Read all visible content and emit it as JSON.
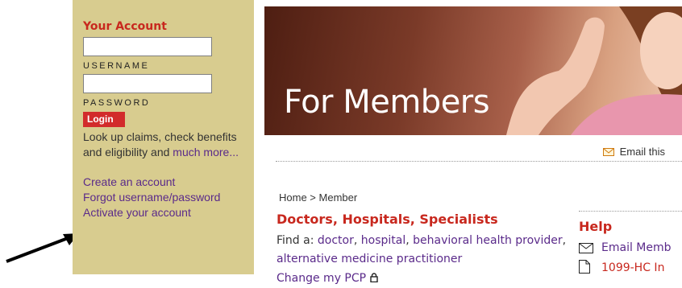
{
  "account": {
    "title": "Your Account",
    "username_label": "USERNAME",
    "password_label": "PASSWORD",
    "username_value": "",
    "password_value": "",
    "login_label": "Login",
    "blurb": "Look up claims, check benefits and eligibility and",
    "blurb_link": "much more...",
    "links": [
      "Create an account",
      "Forgot username/password",
      "Activate your account"
    ]
  },
  "hero": {
    "title": "For Members"
  },
  "email_top": "Email this",
  "breadcrumb": {
    "home": "Home",
    "separator": " > ",
    "current": "Member"
  },
  "main": {
    "section_title": "Doctors, Hospitals, Specialists",
    "find_prefix": "Find a: ",
    "find_links": [
      "doctor",
      "hospital",
      "behavioral health provider",
      "alternative medicine practitioner"
    ],
    "change_pcp": "Change my PCP"
  },
  "help": {
    "title": "Help",
    "items": [
      {
        "label": "Email Memb",
        "icon": "envelope-icon",
        "color": "#5a2a8a"
      },
      {
        "label": "1099-HC In",
        "icon": "document-icon",
        "color": "#c8281e"
      }
    ]
  },
  "colors": {
    "accent_red": "#c8281e",
    "link_purple": "#5a2a8a",
    "sidebar_bg": "#d8cc8f"
  }
}
